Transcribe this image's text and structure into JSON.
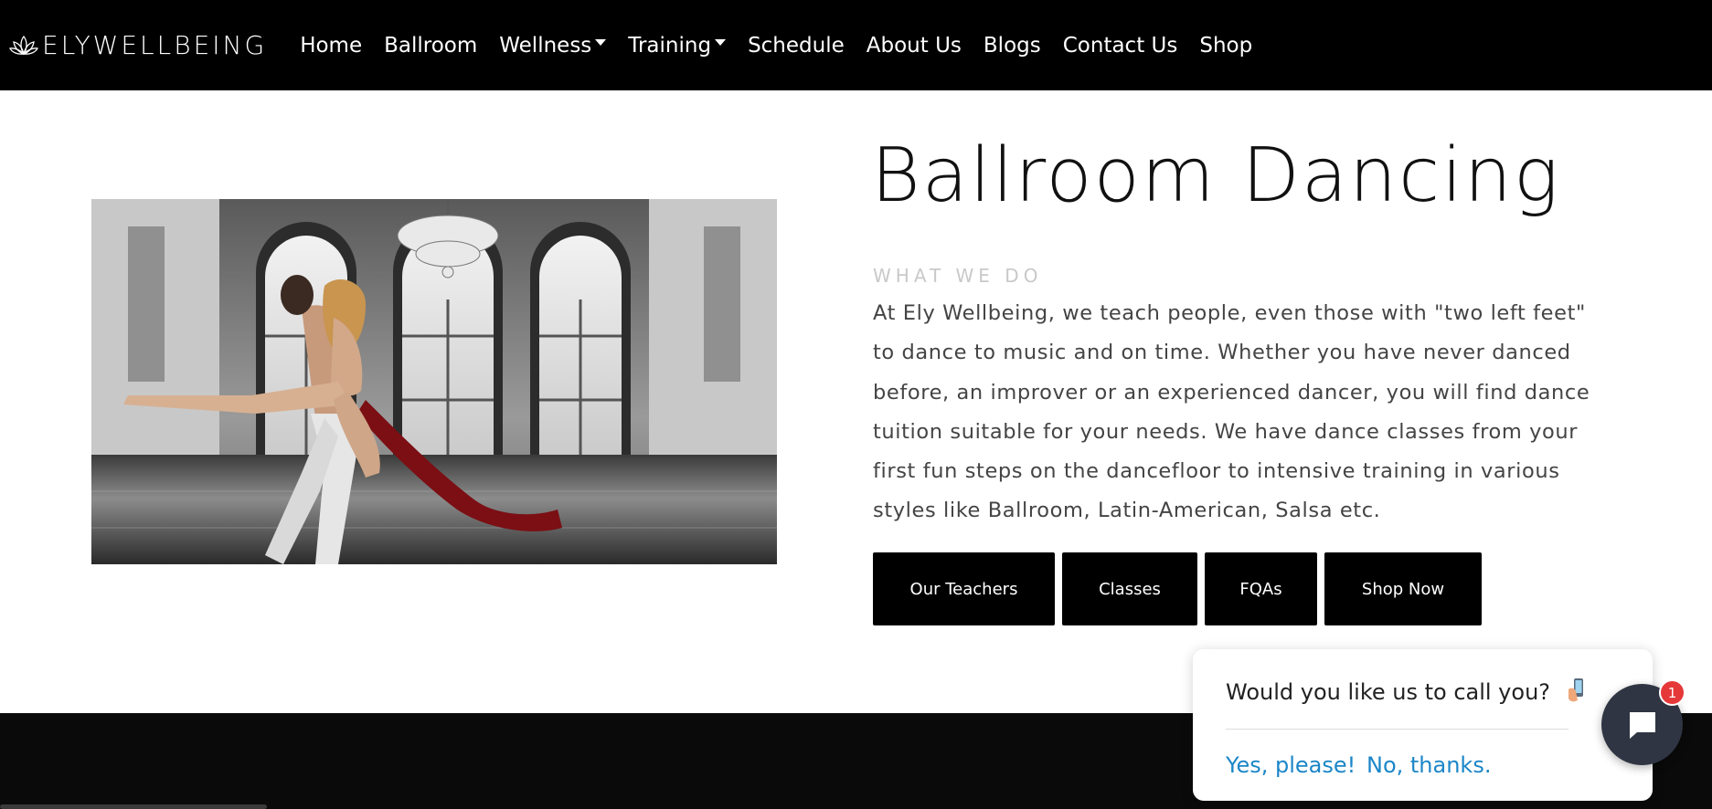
{
  "brand": {
    "name": "ELYWELLBEING",
    "logo_icon": "lotus-icon"
  },
  "nav": {
    "items": [
      {
        "label": "Home",
        "dropdown": false
      },
      {
        "label": "Ballroom",
        "dropdown": false
      },
      {
        "label": "Wellness",
        "dropdown": true
      },
      {
        "label": "Training",
        "dropdown": true
      },
      {
        "label": "Schedule",
        "dropdown": false
      },
      {
        "label": "About Us",
        "dropdown": false
      },
      {
        "label": "Blogs",
        "dropdown": false
      },
      {
        "label": "Contact Us",
        "dropdown": false
      },
      {
        "label": "Shop",
        "dropdown": false
      }
    ]
  },
  "hero": {
    "title": "Ballroom Dancing",
    "subtitle": "WHAT WE DO",
    "description": "At Ely Wellbeing, we teach people, even those with \"two left feet\" to dance to music and on time. Whether you have never danced before, an improver or an experienced dancer, you will find dance tuition suitable for your needs. We have dance classes from your first fun steps on the dancefloor to intensive training in various styles like Ballroom, Latin-American, Salsa etc.",
    "buttons": {
      "teachers": "Our Teachers",
      "classes": "Classes",
      "fqas": "FQAs",
      "shop": "Shop Now"
    }
  },
  "call_popup": {
    "question": "Would you like us to call you?",
    "yes_label": "Yes, please!",
    "no_label": "No, thanks."
  },
  "chat": {
    "badge_count": "1",
    "icon": "chat-bubble-icon"
  },
  "colors": {
    "nav_background": "#000000",
    "button_background": "#000000",
    "link_blue": "#1b86c8",
    "badge_red": "#e53939",
    "chat_button": "#2f3542"
  }
}
